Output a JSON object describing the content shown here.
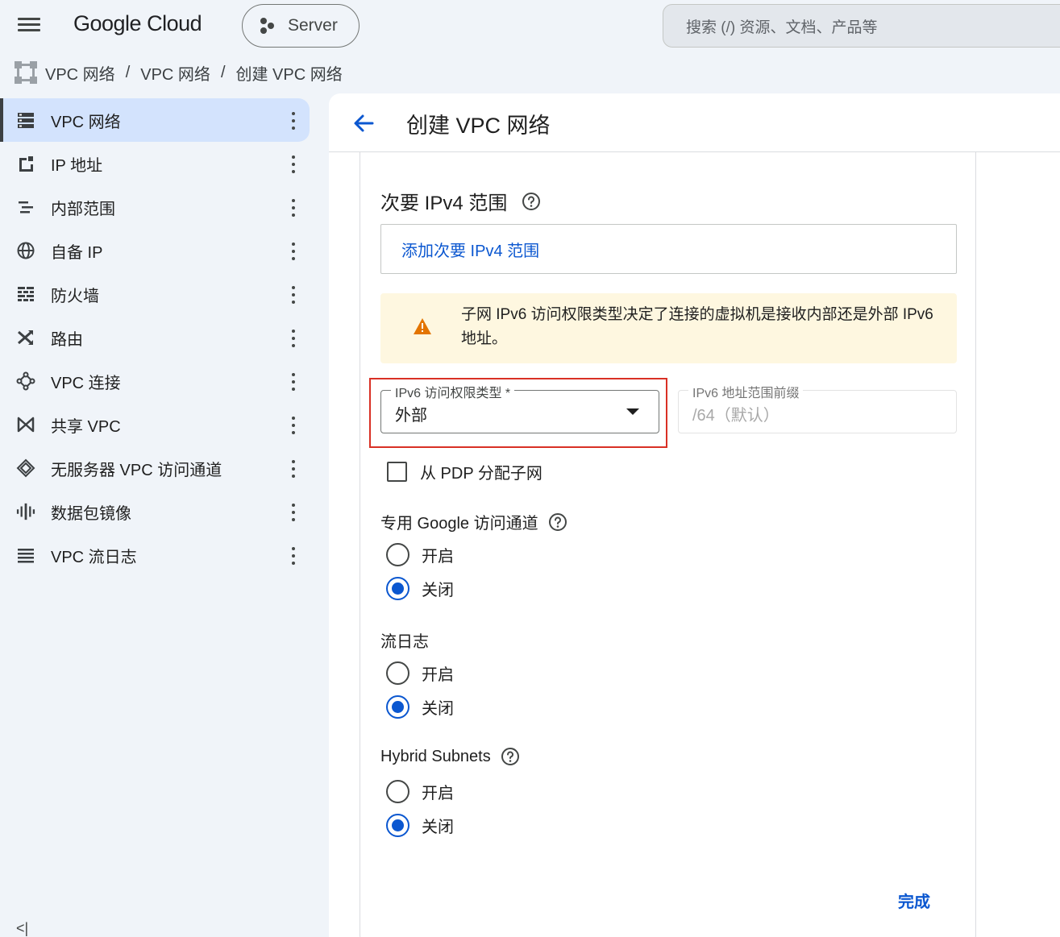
{
  "header": {
    "logo": "Google Cloud",
    "project_label": "Server",
    "search_placeholder": "搜索 (/) 资源、文档、产品等"
  },
  "breadcrumb": [
    "VPC 网络",
    "VPC 网络",
    "创建 VPC 网络"
  ],
  "sidebar": {
    "items": [
      {
        "label": "VPC 网络",
        "icon": "vpc-network-icon",
        "active": true
      },
      {
        "label": "IP 地址",
        "icon": "ip-address-icon"
      },
      {
        "label": "内部范围",
        "icon": "internal-ranges-icon"
      },
      {
        "label": "自备 IP",
        "icon": "globe-icon"
      },
      {
        "label": "防火墙",
        "icon": "firewall-icon"
      },
      {
        "label": "路由",
        "icon": "routes-icon"
      },
      {
        "label": "VPC 连接",
        "icon": "connectivity-icon"
      },
      {
        "label": "共享 VPC",
        "icon": "shared-vpc-icon"
      },
      {
        "label": "无服务器 VPC 访问通道",
        "icon": "serverless-icon"
      },
      {
        "label": "数据包镜像",
        "icon": "packet-mirroring-icon"
      },
      {
        "label": "VPC 流日志",
        "icon": "flow-logs-icon"
      }
    ],
    "collapse_label": "<|"
  },
  "page": {
    "title": "创建 VPC 网络",
    "secondary_ranges_title": "次要 IPv4 范围",
    "add_secondary_range": "添加次要 IPv4 范围",
    "warning_text": "子网 IPv6 访问权限类型决定了连接的虚拟机是接收内部还是外部 IPv6 地址。",
    "ipv6_access_type_label": "IPv6 访问权限类型 *",
    "ipv6_access_type_value": "外部",
    "ipv6_prefix_label": "IPv6 地址范围前缀",
    "ipv6_prefix_value": "/64（默认）",
    "pdp_checkbox_label": "从 PDP 分配子网",
    "private_google_access": {
      "title": "专用 Google 访问通道",
      "on": "开启",
      "off": "关闭",
      "selected": "off"
    },
    "flow_logs": {
      "title": "流日志",
      "on": "开启",
      "off": "关闭",
      "selected": "off"
    },
    "hybrid_subnets": {
      "title": "Hybrid Subnets",
      "on": "开启",
      "off": "关闭",
      "selected": "off"
    },
    "done_label": "完成"
  },
  "colors": {
    "accent": "#0b57d0",
    "highlight_border": "#d93025",
    "warning_bg": "#fef7e0",
    "warning_icon": "#e37400"
  }
}
